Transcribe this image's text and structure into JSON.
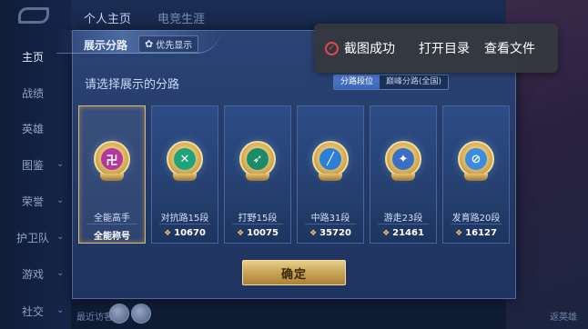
{
  "background": {
    "top_tabs": [
      "个人主页",
      "电竞生涯"
    ],
    "nav_items": [
      {
        "label": "主页",
        "active": true
      },
      {
        "label": "战绩",
        "active": false
      },
      {
        "label": "英雄",
        "active": false
      },
      {
        "label": "图鉴",
        "active": false
      },
      {
        "label": "荣誉",
        "active": false
      },
      {
        "label": "护卫队",
        "active": false
      },
      {
        "label": "游戏",
        "active": false
      },
      {
        "label": "社交",
        "active": false
      }
    ],
    "bottom_left_text": "最近访客",
    "bottom_right_text": "返英雄"
  },
  "modal": {
    "title": "展示分路",
    "priority_button": "优先显示",
    "prompt": "请选择展示的分路",
    "segments": [
      {
        "label": "分路段位",
        "active": true
      },
      {
        "label": "巅峰分路(全国)",
        "active": false
      }
    ],
    "cards": [
      {
        "name": "全能高手",
        "score": "",
        "label": "全能称号",
        "selected": true,
        "badge_color": "#b0389e",
        "badge_glyph": "卍"
      },
      {
        "name": "对抗路15段",
        "score": "10670",
        "label": "",
        "selected": false,
        "badge_color": "#1fa37a",
        "badge_glyph": "✕"
      },
      {
        "name": "打野15段",
        "score": "10075",
        "label": "",
        "selected": false,
        "badge_color": "#1b8c6a",
        "badge_glyph": "➶"
      },
      {
        "name": "中路31段",
        "score": "35720",
        "label": "",
        "selected": false,
        "badge_color": "#2d7ed6",
        "badge_glyph": "╱"
      },
      {
        "name": "游走23段",
        "score": "21461",
        "label": "",
        "selected": false,
        "badge_color": "#3a6fc4",
        "badge_glyph": "✦"
      },
      {
        "name": "发育路20段",
        "score": "16127",
        "label": "",
        "selected": false,
        "badge_color": "#3d8be0",
        "badge_glyph": "⊘"
      }
    ],
    "confirm_label": "确定"
  },
  "toast": {
    "message": "截图成功",
    "open_dir": "打开目录",
    "view_file": "查看文件"
  }
}
